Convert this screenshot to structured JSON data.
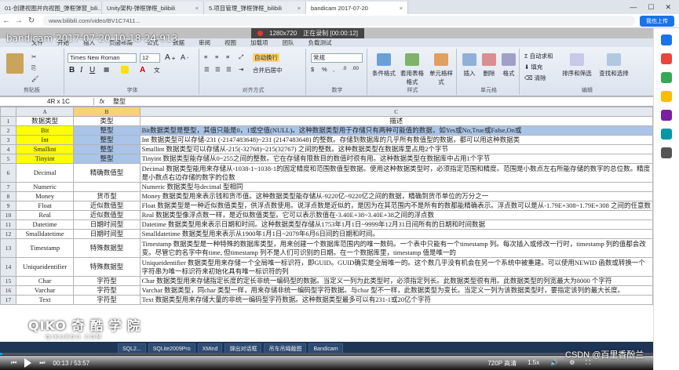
{
  "browser": {
    "tabs": [
      {
        "title": "01-创建视图并向视图_弹框弹窗_bili..."
      },
      {
        "title": "Unity架构-弹框弹框_bilibili"
      },
      {
        "title": "5.项目管理_弹框弹框_bilibili"
      },
      {
        "title": "bandicam 2017-07-20"
      }
    ],
    "url": "www.bilibili.com/video/BV1C7411...",
    "upload_label": "我也上传"
  },
  "recorder": {
    "overlay_title": "bandicam 2017-07-20 10-18-24-913",
    "resolution": "1280x720",
    "status": "正在录制 [00:00:12]"
  },
  "excel": {
    "ribbon_tabs": [
      "文件",
      "开始",
      "插入",
      "页面布局",
      "公式",
      "数据",
      "审阅",
      "视图",
      "加载项",
      "团队",
      "负载测试"
    ],
    "font_name": "Times New Roman",
    "font_size": "12",
    "wrap_label": "自动换行",
    "merge_label": "合并后居中",
    "number_format": "常规",
    "groups": {
      "clipboard": "剪贴板",
      "font": "字体",
      "align": "对齐方式",
      "number": "数字",
      "styles": "样式",
      "cells": "单元格",
      "edit": "编辑"
    },
    "style_buttons": [
      "条件格式",
      "套用表格格式",
      "单元格样式"
    ],
    "cell_buttons": [
      "插入",
      "删除",
      "格式"
    ],
    "edit_buttons": [
      "自动求和",
      "填充",
      "清除",
      "排序和筛选",
      "查找和选择"
    ],
    "name_box": "4R x 1C",
    "fx": "fx",
    "formula": "整型",
    "col_headers": [
      "A",
      "B",
      "C"
    ],
    "header_row": {
      "a": "数据类型",
      "b": "类型",
      "c": "描述"
    },
    "rows": [
      {
        "n": "2",
        "a": "Bit",
        "b": "整型",
        "c": "Bit数据类型是整型，其值只能是0，1或空值(NULL)。这种数据类型用于存储只有两种可能值的数据，如Yes或No,True或False,On或"
      },
      {
        "n": "3",
        "a": "Int",
        "b": "整型",
        "c": "Int 数据类型可以存储-231  (-2147483648)~231 (2147483648)  的整数。存储到数据库的几乎所有数值型的数据，都可以用这种数据类"
      },
      {
        "n": "4",
        "a": "Smallint",
        "b": "整型",
        "c": "Smallint 数据类型可以存储从-215(-32768)~215(32767) 之间的整数。这种数据类型在数据库里占用2个字节"
      },
      {
        "n": "5",
        "a": "Tinyint",
        "b": "整型",
        "c": "Tinyint 数据类型能存储从0~255之间的整数。它在存储有限数目的数值时很有用。这种数据类型在数据库中占用1个字节"
      },
      {
        "n": "6",
        "a": "Decimal",
        "b": "精确数值型",
        "c": "Decimal 数据类型能用来存储从-1038-1~1038-1的固定精度和范围数值型数据。使用这种数据类型时，必须指定范围和精度。范围是小数点左右所能存储的数字的总位数。精度是小数点右边存储的数字的位数",
        "tall": true
      },
      {
        "n": "7",
        "a": "Numeric",
        "b": "",
        "c": "Numeric 数据类型与decimal 型相同"
      },
      {
        "n": "8",
        "a": "Money",
        "b": "货币型",
        "c": "Money 数据类型用来表示钱和货币值。这种数据类型能存储从-9220亿~9220亿之间的数据，精确到货币单位的万分之一"
      },
      {
        "n": "9",
        "a": "Float",
        "b": "近似数值型",
        "c": "Float 数据类型是一种近似数值类型，供浮点数使用。说浮点数是近似的，是因为在其范围内不是所有的数都能精确表示。浮点数可以是从-1.79E+308~1.79E+308 之间的任意数"
      },
      {
        "n": "10",
        "a": "Real",
        "b": "近似数值型",
        "c": "Real 数据类型像浮点数一样，是近似数值类型。它可以表示数值在-3.40E+38~3.40E+38之间的浮点数"
      },
      {
        "n": "11",
        "a": "Datetime",
        "b": "日期时间型",
        "c": "Datetime 数据类型用来表示日期和时间。这种数据类型存储从1753年1月1日~9999年12月31日间所有的日期和时间数据"
      },
      {
        "n": "12",
        "a": "Smalldatetime",
        "b": "日期时间型",
        "c": "Smalldatetime 数据类型用来表示从1900年1月1日~2079年6月6日间的日期和时间。"
      },
      {
        "n": "13",
        "a": "Timestamp",
        "b": "特殊数据型",
        "c": "Timestamp 数据类型是一种特殊的数据库类型，用来创建一个数据库范围内的唯一数码。一个表中只能有一个timestamp 列。每次插入或修改一行时，timestamp 列的值都会改变。尽管它的名字中有time, 但timestamp 列不是人们可识别的日期。在一个数据库里，timestamp 值是唯一的",
        "tall": true
      },
      {
        "n": "14",
        "a": "Uniqueidentifier",
        "b": "特殊数据型",
        "c": "Uniqueidentifier 数据类型用来存储一个全局唯一标识符，即GUID。GUID确实是全局唯一的。这个数几乎没有机会在另一个系统中被重建。可以使用NEWID 函数或转换一个字符串为唯一标识符来初始化具有唯一标识符的列",
        "tall": true
      },
      {
        "n": "15",
        "a": "Char",
        "b": "字符型",
        "c": "Char 数据类型用来存储指定长度的定长非统一编码型的数据。当定义一列为此类型时，必须指定列长。此数据类型很有用。此数据类型的列宽最大为8000 个字符"
      },
      {
        "n": "16",
        "a": "Varchar",
        "b": "字符型",
        "c": "Varchar 数据类型，同char 类型一样，用来存储非统一编码型字符数据。与char 型不一样，此数据类型为变长。当定义一列为该数据类型时，要指定该列的最大长度。"
      },
      {
        "n": "17",
        "a": "Text",
        "b": "字符型",
        "c": "Text 数据类型用来存储大量的非统一编码型字符数据。这种数据类型最多可以有231-1或20亿个字符"
      }
    ]
  },
  "taskbar_items": [
    "SQL2...",
    "SQLite2009Pro",
    "XMind",
    "弹出对话框",
    "吊车吊绳截图",
    "Bandicam"
  ],
  "logo": {
    "main": "QIKO 奇 酷 学 院",
    "sub": "QIKUEDU.COM"
  },
  "player": {
    "time": "00:13 / 53:57",
    "quality": "720P 高清",
    "speed": "1.5x"
  },
  "watermark": "CSDN @百里香酚兰",
  "colors": {
    "selection": "#a9c4e8",
    "highlight": "#ffff00",
    "progress": "#00a1d6"
  }
}
